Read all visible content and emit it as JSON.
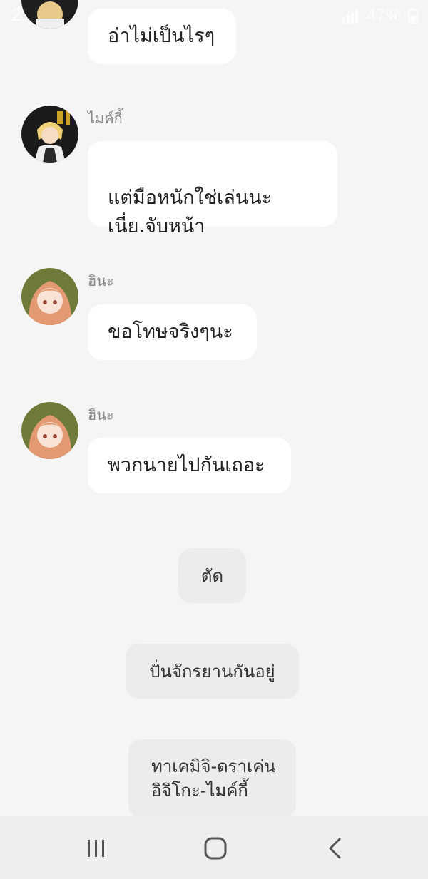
{
  "status_bar": {
    "time": "21:20",
    "battery": "47%"
  },
  "messages": [
    {
      "sender": "",
      "text": "อ่าไม่เป็นไรๆ",
      "avatar": "character-avatar-1"
    },
    {
      "sender": "ไมค์กี้",
      "text": "แต่มือหนักใช่เล่นนะ\nเนี่ย.จับหน้า",
      "avatar": "mikey-avatar"
    },
    {
      "sender": "ฮินะ",
      "text": "ขอโทษจริงๆนะ",
      "avatar": "hina-avatar"
    },
    {
      "sender": "ฮินะ",
      "text": "พวกนายไปกันเถอะ",
      "avatar": "hina-avatar"
    }
  ],
  "choices": [
    {
      "text": "ตัด"
    },
    {
      "text": "ปั่นจักรยานกันอยู่"
    },
    {
      "text": "ทาเคมิจิ-ดราเค่น\nอิจิโกะ-ไมค์กี้"
    }
  ],
  "nav": {
    "recent_icon": "recent-apps-icon",
    "home_icon": "home-icon",
    "back_icon": "back-icon"
  },
  "colors": {
    "background": "#f5f5f5",
    "bubble": "#ffffff",
    "choice": "#ececec",
    "nav_bar": "#eeeeee"
  }
}
